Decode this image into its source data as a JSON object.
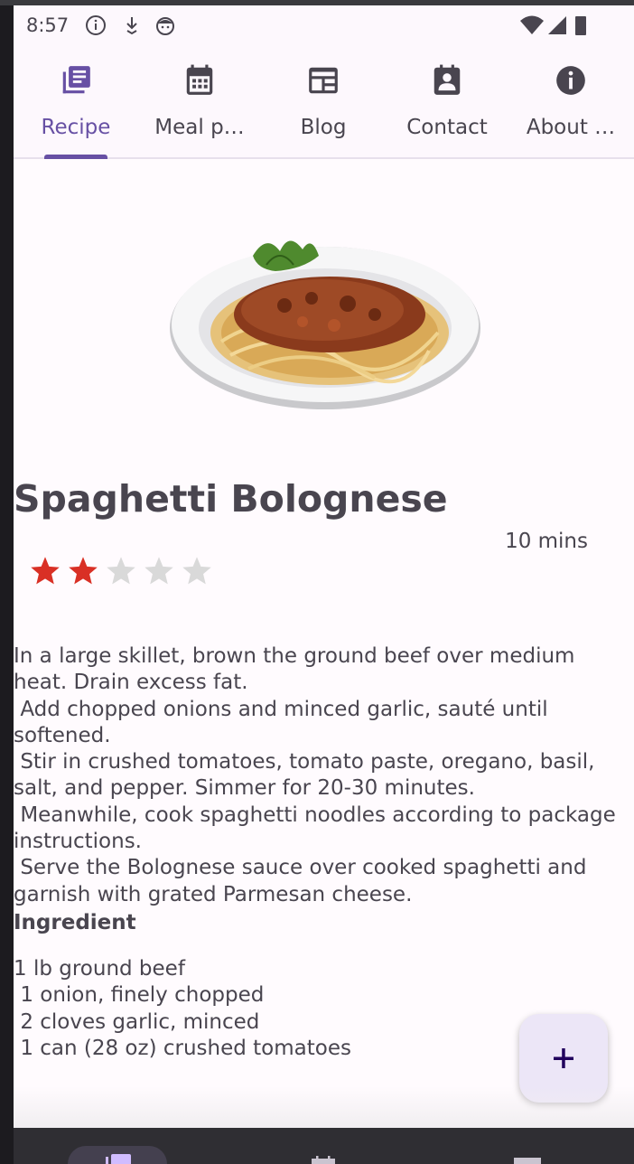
{
  "status_bar": {
    "time": "8:57",
    "icons": [
      "info-circle-icon",
      "download-icon",
      "face-icon",
      "wifi-icon",
      "signal-icon",
      "battery-icon"
    ]
  },
  "tabs": [
    {
      "label": "Recipe",
      "icon": "recipe-book-icon",
      "active": true
    },
    {
      "label": "Meal p…",
      "icon": "calendar-icon",
      "active": false
    },
    {
      "label": "Blog",
      "icon": "blog-icon",
      "active": false
    },
    {
      "label": "Contact",
      "icon": "contact-card-icon",
      "active": false
    },
    {
      "label": "About …",
      "icon": "info-icon",
      "active": false
    }
  ],
  "recipe": {
    "title": "Spaghetti Bolognese",
    "time": "10 mins",
    "rating": 2,
    "rating_max": 5,
    "instructions": "In a large skillet, brown the ground beef over medium heat. Drain excess fat.\n Add chopped onions and minced garlic, sauté until softened.\n Stir in crushed tomatoes, tomato paste, oregano, basil, salt, and pepper. Simmer for 20-30 minutes.\n Meanwhile, cook spaghetti noodles according to package instructions.\n Serve the Bolognese sauce over cooked spaghetti and garnish with grated Parmesan cheese.",
    "ingredient_heading": "Ingredient",
    "ingredients": "1 lb ground beef\n 1 onion, finely chopped\n 2 cloves garlic, minced\n 1 can (28 oz) crushed tomatoes"
  },
  "colors": {
    "accent": "#6750a4",
    "text": "#49454f",
    "star_filled": "#d93025",
    "star_empty": "#d9d9d9",
    "fab_bg": "#ece6f7"
  },
  "fab": {
    "icon": "plus-icon"
  }
}
